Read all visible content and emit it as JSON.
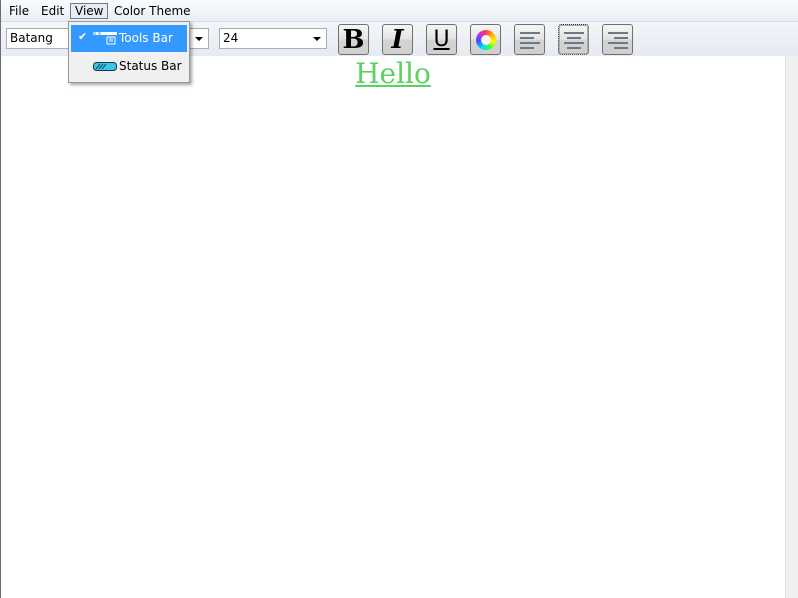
{
  "menubar": {
    "items": [
      {
        "label": "File"
      },
      {
        "label": "Edit"
      },
      {
        "label": "View"
      },
      {
        "label": "Color Theme"
      }
    ]
  },
  "view_menu": {
    "items": [
      {
        "label": "Tools Bar",
        "checked": true,
        "icon": "toolbar-icon"
      },
      {
        "label": "Status Bar",
        "checked": false,
        "icon": "status-bar-icon"
      }
    ],
    "check_glyph": "✔"
  },
  "toolbar": {
    "font_family": "Batang",
    "font_size": "24",
    "bold_glyph": "B",
    "italic_glyph": "I",
    "underline_glyph": "U",
    "color_icon": "color-wheel-icon",
    "align_left_icon": "align-left-icon",
    "align_center_icon": "align-center-icon",
    "align_right_icon": "align-right-icon"
  },
  "document": {
    "text": "Hello",
    "color": "#5ad161"
  },
  "colors": {
    "selection": "#3399ff",
    "menubar": "#e9edf5"
  }
}
